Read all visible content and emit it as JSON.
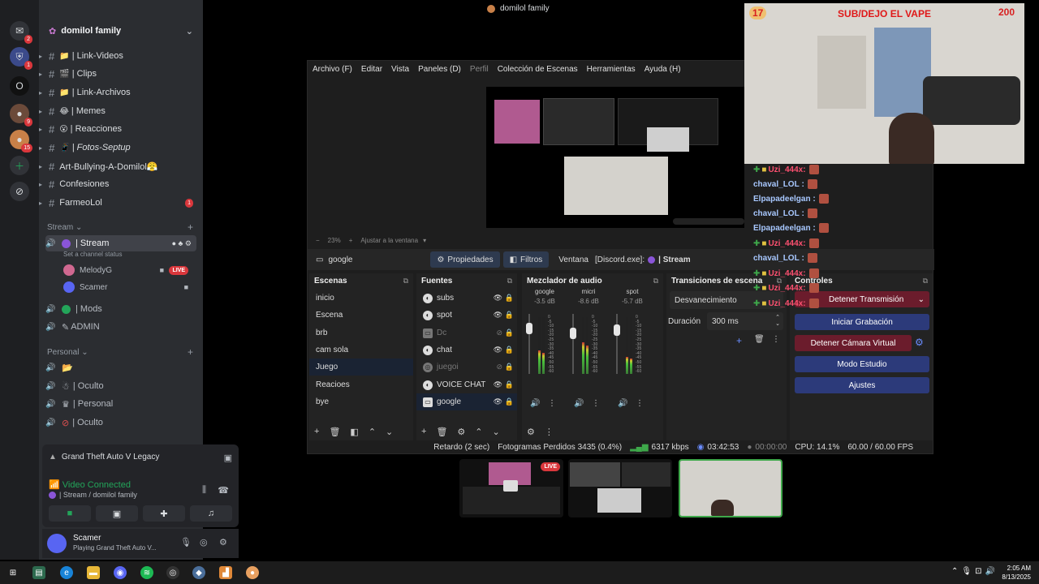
{
  "discord": {
    "server_name": "domilol family",
    "window_title": "domilol family",
    "rail": [
      {
        "icon": "discord-icon",
        "badge": ""
      },
      {
        "icon": "shield-server-icon",
        "badge": "1"
      },
      {
        "icon": "o-server-icon",
        "badge": ""
      },
      {
        "icon": "server-avatar-icon",
        "badge": "9"
      },
      {
        "icon": "server-avatar2-icon",
        "badge": "15"
      },
      {
        "icon": "add-server-icon",
        "badge": ""
      },
      {
        "icon": "explore-icon",
        "badge": ""
      }
    ],
    "rail_badge_top": "2",
    "channels": [
      {
        "emoji": "📁",
        "name": "| Link-Videos",
        "badge": ""
      },
      {
        "emoji": "🎬",
        "name": "| Clips",
        "badge": ""
      },
      {
        "emoji": "📁",
        "name": "| Link-Archivos",
        "badge": ""
      },
      {
        "emoji": "😂",
        "name": "| Memes",
        "badge": ""
      },
      {
        "emoji": "😮",
        "name": "| Reacciones",
        "badge": ""
      },
      {
        "emoji": "📱",
        "name": "| Fotos-Septup",
        "badge": ""
      },
      {
        "emoji": "",
        "name": "Art-Bullying-A-Domilol😤",
        "badge": ""
      },
      {
        "emoji": "",
        "name": "Confesiones",
        "badge": ""
      },
      {
        "emoji": "",
        "name": "FarmeoLol",
        "badge": "1"
      }
    ],
    "category_stream": "Stream",
    "voice_stream": "| Stream",
    "channel_status": "Set a channel status",
    "voice_users": [
      {
        "name": "MelodyG",
        "live": "LIVE"
      },
      {
        "name": "Scamer",
        "live": ""
      }
    ],
    "voice_mods": "| Mods",
    "voice_admin": "ADMIN",
    "category_personal": "Personal",
    "personal_channels": [
      "",
      "| Oculto",
      "| Personal",
      "| Oculto"
    ],
    "activity": "Grand Theft Auto V Legacy",
    "video_connected": "Video Connected",
    "voice_location": "| Stream / domilol family",
    "user_name": "Scamer",
    "user_status": "Playing Grand Theft Auto V...",
    "live_label": "LIVE"
  },
  "obs": {
    "menu": [
      "Archivo (F)",
      "Editar",
      "Vista",
      "Paneles (D)",
      "Perfil",
      "Colección de Escenas",
      "Herramientas",
      "Ayuda (H)"
    ],
    "zoom": "23%",
    "zoom_mode": "Ajustar a la ventana",
    "selected_source": "google",
    "properties_btn": "Propiedades",
    "filters_btn": "Filtros",
    "window_label": "Ventana",
    "window_value": "[Discord.exe]: ",
    "window_value2": "| Stream",
    "docks": {
      "scenes": "Escenas",
      "sources": "Fuentes",
      "mixer": "Mezclador de audio",
      "transitions": "Transiciones de escena",
      "controls": "Controles"
    },
    "scenes": [
      "inicio",
      "Escena",
      "brb",
      "cam sola",
      "Juego",
      "Reacioes",
      "bye"
    ],
    "selected_scene": "Juego",
    "sources": [
      {
        "name": "subs",
        "dim": false
      },
      {
        "name": "spot",
        "dim": false
      },
      {
        "name": "Dc",
        "dim": true
      },
      {
        "name": "chat",
        "dim": false
      },
      {
        "name": "juegoi",
        "dim": true
      },
      {
        "name": "VOICE CHAT",
        "dim": false
      },
      {
        "name": "google",
        "dim": false
      }
    ],
    "mixer": [
      {
        "name": "google",
        "db": "-3.5 dB",
        "level": 0.42,
        "fader": 0.82
      },
      {
        "name": "micri",
        "db": "-8.6 dB",
        "level": 0.55,
        "fader": 0.72
      },
      {
        "name": "spot",
        "db": "-5.7 dB",
        "level": 0.3,
        "fader": 0.78
      }
    ],
    "meter_scale": [
      "0",
      "-5",
      "-10",
      "-15",
      "-20",
      "-25",
      "-30",
      "-35",
      "-40",
      "-45",
      "-50",
      "-55",
      "-60"
    ],
    "transition": "Desvanecimiento",
    "duration_label": "Duración",
    "duration_value": "300 ms",
    "controls": {
      "stream": "Detener Transmisión",
      "record": "Iniciar Grabación",
      "virtual_cam": "Detener Cámara Virtual",
      "studio": "Modo Estudio",
      "settings": "Ajustes"
    },
    "status": {
      "delay": "Retardo (2 sec)",
      "dropped": "Fotogramas Perdidos 3435 (0.4%)",
      "bitrate": "6317 kbps",
      "stream_time": "03:42:53",
      "rec_time": "00:00:00",
      "cpu": "CPU: 14.1%",
      "fps": "60.00 / 60.00 FPS"
    }
  },
  "overlay": {
    "left_num": "17",
    "title": "SUB/DEJO EL VAPE",
    "right_num": "200"
  },
  "chat": [
    {
      "user": "Uzi_444x",
      "uzi": true
    },
    {
      "user": "chaval_LOL",
      "uzi": false
    },
    {
      "user": "Elpapadeelgan",
      "uzi": false
    },
    {
      "user": "chaval_LOL",
      "uzi": false
    },
    {
      "user": "Elpapadeelgan",
      "uzi": false
    },
    {
      "user": "Uzi_444x",
      "uzi": true
    },
    {
      "user": "chaval_LOL",
      "uzi": false
    },
    {
      "user": "Uzi_444x",
      "uzi": true
    },
    {
      "user": "Uzi_444x",
      "uzi": true
    },
    {
      "user": "Uzi_444x",
      "uzi": true
    }
  ],
  "taskbar": {
    "time": "2:05 AM",
    "date": "8/13/2025",
    "icons": [
      "windows-start-icon",
      "terminal-icon",
      "edge-icon",
      "file-explorer-icon",
      "discord-app-icon",
      "spotify-icon",
      "obs-icon",
      "browser-icon",
      "editor-icon",
      "app-icon"
    ]
  },
  "colors": {
    "discord_bg": "#2b2d31",
    "obs_bg": "#1e1e1e",
    "accent_blue": "#2c3a7a",
    "live_red": "#da373c",
    "connected_green": "#23a55a"
  }
}
